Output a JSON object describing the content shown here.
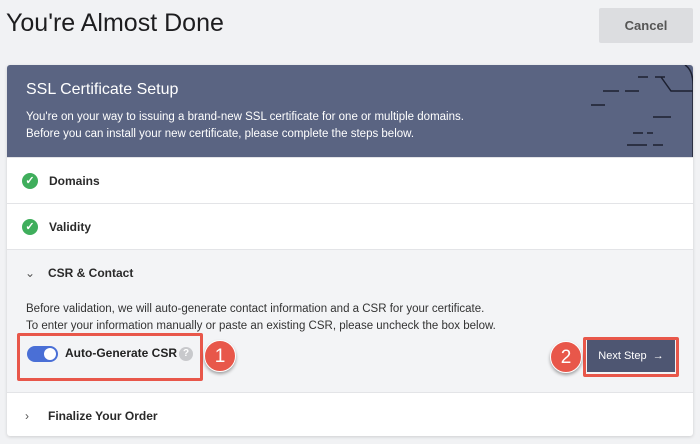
{
  "page": {
    "title": "You're Almost Done",
    "cancel_label": "Cancel"
  },
  "header": {
    "title": "SSL Certificate Setup",
    "line1": "You're on your way to issuing a brand-new SSL certificate for one or multiple domains.",
    "line2": "Before you can install your new certificate, please complete the steps below."
  },
  "steps": [
    {
      "label": "Domains",
      "status": "complete"
    },
    {
      "label": "Validity",
      "status": "complete"
    },
    {
      "label": "CSR & Contact",
      "status": "expanded"
    },
    {
      "label": "Finalize Your Order",
      "status": "collapsed"
    }
  ],
  "csr": {
    "line1": "Before validation, we will auto-generate contact information and a CSR for your certificate.",
    "line2": "To enter your information manually or paste an existing CSR, please uncheck the box below.",
    "toggle_label": "Auto-Generate CSR",
    "toggle_on": true,
    "help": "?",
    "next_label": "Next Step",
    "next_arrow": "→"
  },
  "annotations": [
    "1",
    "2"
  ],
  "icons": {
    "check": "✓",
    "chev_down": "⌄",
    "chev_right": "›"
  },
  "colors": {
    "header": "#5a6482",
    "accent": "#4a6fd6",
    "success": "#3fae5c",
    "annotation": "#e8574a"
  }
}
